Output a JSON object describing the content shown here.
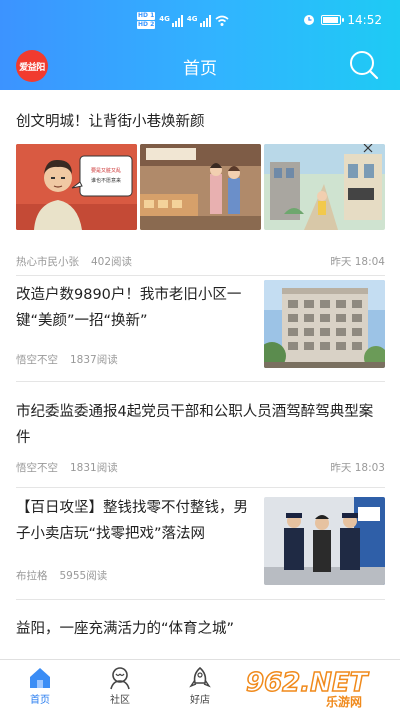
{
  "status_bar": {
    "sim1": "HD 1",
    "sim2": "HD 2",
    "network1": "4G",
    "network2": "4G",
    "time": "14:52"
  },
  "header": {
    "logo_text": "爱益阳",
    "title": "首页"
  },
  "articles": [
    {
      "title": "创文明城！让背街小巷焕新颜",
      "author": "热心市民小张",
      "reads": "402阅读",
      "time": "昨天 18:04",
      "images": [
        "cartoon-man-speaking",
        "cartoon-shop-street",
        "cartoon-alley-scene"
      ],
      "bubble_text": "要是又脏又乱的样子，谁也不愿意来啊"
    },
    {
      "title": "改造户数9890户！我市老旧小区一键“美颜”一招“换新”",
      "author": "悟空不空",
      "reads": "1837阅读",
      "time": "",
      "images": [
        "residential-building-photo"
      ]
    },
    {
      "title": "市纪委监委通报4起党员干部和公职人员酒驾醉驾典型案件",
      "author": "悟空不空",
      "reads": "1831阅读",
      "time": "昨天 18:03",
      "images": []
    },
    {
      "title": "【百日攻坚】整钱找零不付整钱，男子小卖店玩“找零把戏”落法网",
      "author": "布拉格",
      "reads": "5955阅读",
      "time": "",
      "images": [
        "police-arrest-photo"
      ]
    },
    {
      "title": "益阳，一座充满活力的“体育之城”",
      "author": "",
      "reads": "",
      "time": "",
      "images": []
    }
  ],
  "tabbar": {
    "tabs": [
      {
        "label": "首页",
        "icon": "home-icon",
        "active": true
      },
      {
        "label": "社区",
        "icon": "community-icon",
        "active": false
      },
      {
        "label": "好店",
        "icon": "shop-icon",
        "active": false
      }
    ]
  },
  "watermark": {
    "text": "962.NET",
    "sub": "乐游网"
  },
  "colors": {
    "header_start": "#3c93ff",
    "header_end": "#1ecbf4",
    "logo_bg": "#f13b2f",
    "active_tab": "#2a7ef0",
    "meta_text": "#999999"
  }
}
